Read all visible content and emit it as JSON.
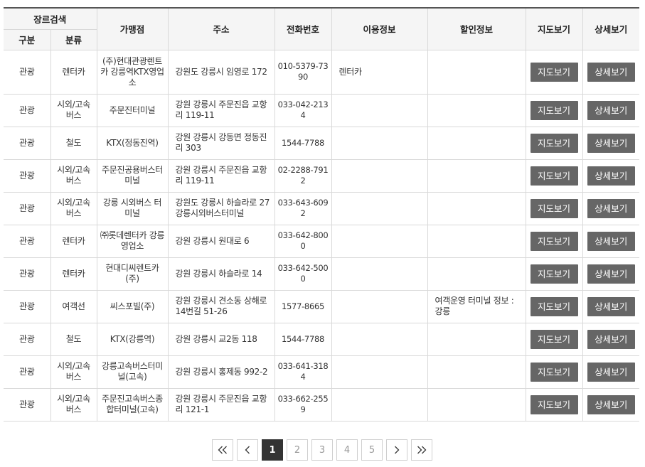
{
  "headers": {
    "genre_search": "장르검색",
    "category": "구분",
    "subcategory": "분류",
    "store": "가맹점",
    "address": "주소",
    "phone": "전화번호",
    "usage_info": "이용정보",
    "discount_info": "할인정보",
    "map": "지도보기",
    "detail": "상세보기"
  },
  "rows": [
    {
      "category": "관광",
      "subcategory": "렌터카",
      "store": "(주)현대관광렌트카 강릉역KTX영업소",
      "address": "강원도 강릉시 임영로 172",
      "phone": "010-5379-7390",
      "usage": "렌터카",
      "discount": "",
      "map_label": "지도보기",
      "detail_label": "상세보기"
    },
    {
      "category": "관광",
      "subcategory": "시외/고속버스",
      "store": "주문진터미널",
      "address": "강원 강릉시 주문진읍 교항리 119-11",
      "phone": "033-042-2134",
      "usage": "",
      "discount": "",
      "map_label": "지도보기",
      "detail_label": "상세보기"
    },
    {
      "category": "관광",
      "subcategory": "철도",
      "store": "KTX(정동진역)",
      "address": "강원 강릉시 강동면 정동진리 303",
      "phone": "1544-7788",
      "usage": "",
      "discount": "",
      "map_label": "지도보기",
      "detail_label": "상세보기"
    },
    {
      "category": "관광",
      "subcategory": "시외/고속버스",
      "store": "주문진공용버스터미널",
      "address": "강원 강릉시 주문진읍 교항리 119-11",
      "phone": "02-2288-7912",
      "usage": "",
      "discount": "",
      "map_label": "지도보기",
      "detail_label": "상세보기"
    },
    {
      "category": "관광",
      "subcategory": "시외/고속버스",
      "store": "강릉 시외버스 터미널",
      "address": "강원도 강릉시 하슬라로 27 강릉시외버스터미널",
      "phone": "033-643-6092",
      "usage": "",
      "discount": "",
      "map_label": "지도보기",
      "detail_label": "상세보기"
    },
    {
      "category": "관광",
      "subcategory": "렌터카",
      "store": "㈜롯데렌터카 강릉영업소",
      "address": "강원 강릉시 원대로 6",
      "phone": "033-642-8000",
      "usage": "",
      "discount": "",
      "map_label": "지도보기",
      "detail_label": "상세보기"
    },
    {
      "category": "관광",
      "subcategory": "렌터카",
      "store": "현대디씨렌트카(주)",
      "address": "강원 강릉시 하슬라로 14",
      "phone": "033-642-5000",
      "usage": "",
      "discount": "",
      "map_label": "지도보기",
      "detail_label": "상세보기"
    },
    {
      "category": "관광",
      "subcategory": "여객선",
      "store": "씨스포빌(주)",
      "address": "강원 강릉시 견소동 상해로14번길 51-26",
      "phone": "1577-8665",
      "usage": "",
      "discount": "여객운영 터미널 정보 : 강릉",
      "map_label": "지도보기",
      "detail_label": "상세보기"
    },
    {
      "category": "관광",
      "subcategory": "철도",
      "store": "KTX(강릉역)",
      "address": "강원 강릉시 교2동 118",
      "phone": "1544-7788",
      "usage": "",
      "discount": "",
      "map_label": "지도보기",
      "detail_label": "상세보기"
    },
    {
      "category": "관광",
      "subcategory": "시외/고속버스",
      "store": "강릉고속버스터미널(고속)",
      "address": "강원 강릉시 홍제동 992-2",
      "phone": "033-641-3184",
      "usage": "",
      "discount": "",
      "map_label": "지도보기",
      "detail_label": "상세보기"
    },
    {
      "category": "관광",
      "subcategory": "시외/고속버스",
      "store": "주문진고속버스종합터미널(고속)",
      "address": "강원 강릉시 주문진읍 교항리 121-1",
      "phone": "033-662-2559",
      "usage": "",
      "discount": "",
      "map_label": "지도보기",
      "detail_label": "상세보기"
    }
  ],
  "pagination": {
    "pages": [
      "1",
      "2",
      "3",
      "4",
      "5"
    ],
    "current": "1",
    "first_icon": "double-chevron-left-icon",
    "prev_icon": "chevron-left-icon",
    "next_icon": "chevron-right-icon",
    "last_icon": "double-chevron-right-icon"
  }
}
